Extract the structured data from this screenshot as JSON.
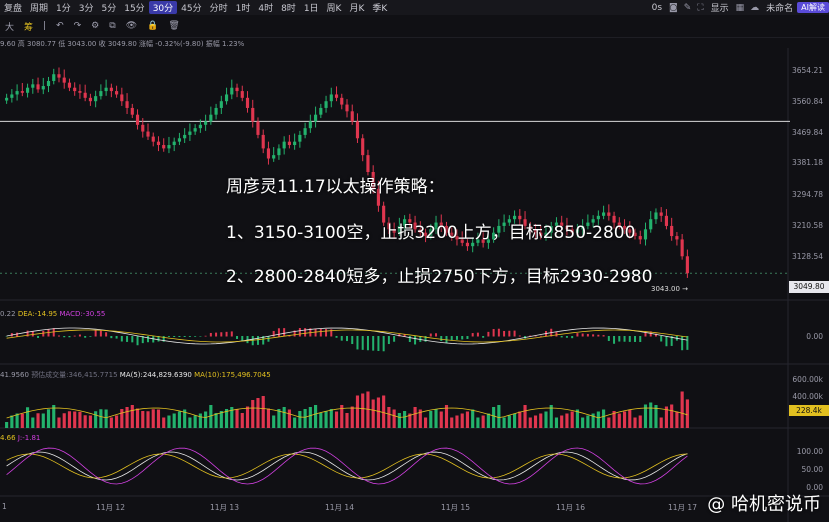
{
  "toolbar": {
    "items": [
      "复盘",
      "周期",
      "1分",
      "3分",
      "5分",
      "15分",
      "30分",
      "45分",
      "分时",
      "1时",
      "4时",
      "8时",
      "1日",
      "周K",
      "月K",
      "季K"
    ],
    "active": "30分",
    "right": {
      "time": "0s",
      "display": "显示",
      "account": "未命名",
      "ai_button": "AI解读"
    }
  },
  "drawbar": {
    "items": [
      "大",
      "筹"
    ]
  },
  "ohlc_text": "9.60 高 3080.77 低 3043.00 收 3049.80 涨幅 -0.32%(-9.80) 振幅 1.23%",
  "price_axis": {
    "ticks": [
      "3654.21",
      "3560.84",
      "3469.84",
      "3381.18",
      "3294.78",
      "3210.58",
      "3128.54"
    ],
    "last_price_label": "3043.00 →",
    "current_price_box": "3049.80"
  },
  "strategy": {
    "title": "周彦灵11.17以太操作策略：",
    "line1": "1、3150-3100空，止损3200上方，目标2850-2800",
    "line2": "2、2800-2840短多，止损2750下方，目标2930-2980"
  },
  "macd": {
    "label_left": "0.22",
    "dea": "DEA:-14.95",
    "macd": "MACD:-30.55",
    "zero_tick": "0.00"
  },
  "volume": {
    "label_left": "41.9560",
    "label_forecast": "预估成交量:346,415.7715",
    "ma5": "MA(5):244,829.6390",
    "ma10": "MA(10):175,496.7045",
    "ticks": [
      "600.00k",
      "400.00k"
    ],
    "current_box": "228.4k"
  },
  "kdj": {
    "label_left": "4.66",
    "j": "J:-1.81",
    "ticks": [
      "100.00",
      "50.00",
      "0.00"
    ]
  },
  "x_axis": {
    "labels": [
      "1",
      "11月 12",
      "11月 13",
      "11月 14",
      "11月 15",
      "11月 16",
      "11月 17"
    ]
  },
  "watermark": "@ 哈机密说币",
  "colors": {
    "up": "#23b26d",
    "down": "#e0364f",
    "ma_white": "#e8e8e8",
    "ma_yellow": "#e2c020",
    "ma_purple": "#d040e0",
    "accent": "#3a3aa8"
  },
  "chart_data": {
    "type": "candlestick",
    "ylim": [
      3000,
      3700
    ],
    "hline": 3500,
    "closes": [
      3570,
      3580,
      3590,
      3585,
      3600,
      3610,
      3595,
      3605,
      3620,
      3640,
      3630,
      3615,
      3600,
      3590,
      3585,
      3570,
      3560,
      3575,
      3590,
      3600,
      3590,
      3580,
      3560,
      3540,
      3520,
      3490,
      3470,
      3455,
      3440,
      3430,
      3420,
      3430,
      3440,
      3450,
      3460,
      3470,
      3480,
      3490,
      3500,
      3520,
      3540,
      3560,
      3580,
      3600,
      3590,
      3570,
      3540,
      3500,
      3460,
      3420,
      3390,
      3400,
      3420,
      3440,
      3430,
      3440,
      3460,
      3480,
      3500,
      3520,
      3540,
      3560,
      3580,
      3570,
      3550,
      3530,
      3500,
      3450,
      3400,
      3350,
      3300,
      3250,
      3200,
      3180,
      3170,
      3190,
      3210,
      3200,
      3180,
      3170,
      3160,
      3180,
      3200,
      3190,
      3170,
      3160,
      3150,
      3140,
      3130,
      3140,
      3150,
      3140,
      3150,
      3170,
      3190,
      3200,
      3210,
      3220,
      3210,
      3190,
      3180,
      3170,
      3160,
      3170,
      3190,
      3200,
      3190,
      3180,
      3170,
      3180,
      3190,
      3200,
      3210,
      3220,
      3230,
      3220,
      3200,
      3190,
      3180,
      3170,
      3160,
      3150,
      3180,
      3210,
      3230,
      3220,
      3190,
      3160,
      3150,
      3100,
      3049.8
    ]
  }
}
